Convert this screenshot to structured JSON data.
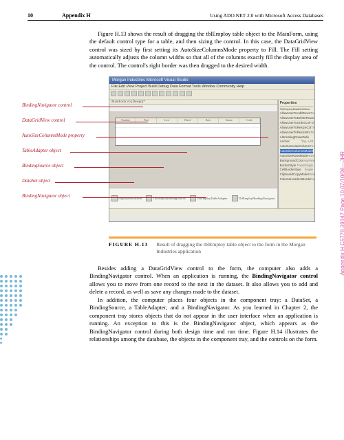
{
  "header": {
    "page_number": "10",
    "appendix": "Appendix H",
    "title": "Using ADO.NET 2.0 with Microsoft Access Databases"
  },
  "paragraphs": {
    "p1": "Figure H.13 shows the result of dragging the tblEmploy table object to the MainForm, using the default control type for a table, and then sizing the control. In this case, the DataGridView control was sized by first setting its AutoSizeColumnsMode property to Fill. The Fill setting automatically adjusts the column widths so that all of the columns exactly fill the display area of the control. The control's right border was then dragged to the desired width.",
    "p2a": "Besides adding a DataGridView control to the form, the computer also adds a BindingNavigator control. When an application is running, the ",
    "p2b": "BindingNavigator control",
    "p2c": " allows you to move from one record to the next in the dataset. It also allows you to add and delete a record, as well as save any changes made to the dataset.",
    "p3": "In addition, the computer places four objects in the component tray: a DataSet, a BindingSource, a TableAdapter, and a BindingNavigator. As you learned in Chapter 2, the component tray stores objects that do not appear in the user interface when an application is running. An exception to this is the BindingNavigator object, which appears as the BindingNavigator control during both design time and run time. Figure H.14 illustrates the relationships among the database, the objects in the component tray, and the controls on the form."
  },
  "annotations": {
    "a1": "BindingNavigator control",
    "a2": "DataGridView control",
    "a3": "AutoSizeColumnsMode property",
    "a4": "TableAdapter object",
    "a5": "BindingSource object",
    "a6": "DataSet object",
    "a7": "BindingNavigator object"
  },
  "screenshot": {
    "title": "Morgan Industries Microsoft Visual Studio",
    "menu": "File  Edit  View  Project  Build  Debug  Data  Format  Tools  Window  Community  Help",
    "tab": "MainForm.vb [Design]*",
    "nav_text": "0  of {0}",
    "grid_headers": [
      "Number",
      "First",
      "Last",
      "Hired",
      "Rate",
      "Status",
      "Code"
    ],
    "tray": [
      "EmployeesDataSet",
      "TblEmployBindingSource",
      "TblEmployTableAdapter",
      "TblEmployBindingNavigator"
    ],
    "props_title": "Properties",
    "props_sub": "TblEmployDataGridView",
    "props": [
      {
        "k": "AllowUserToAddRows",
        "v": "True"
      },
      {
        "k": "AllowUserToDeleteRows",
        "v": "True"
      },
      {
        "k": "AllowUserToOrderCol",
        "v": "False"
      },
      {
        "k": "AllowUserToResizeCol",
        "v": "True"
      },
      {
        "k": "AllowUserToResizeRo",
        "v": "True"
      },
      {
        "k": "AlternatingRowsDefa",
        "v": ""
      },
      {
        "k": "Anchor",
        "v": "Top, Left"
      },
      {
        "k": "AutoGenerateColumn",
        "v": "True"
      },
      {
        "k": "AutoSizeColumnsMode",
        "v": "Fill",
        "hl": true
      },
      {
        "k": "AutoSizeRowsMode",
        "v": "None"
      },
      {
        "k": "BackgroundColor",
        "v": "AppWork"
      },
      {
        "k": "BorderStyle",
        "v": "FixedSingle"
      },
      {
        "k": "CellBorderStyle",
        "v": "Single"
      },
      {
        "k": "ClipboardCopyMode",
        "v": "EnableWi"
      },
      {
        "k": "ColumnHeadersBorde",
        "v": "Raised"
      }
    ]
  },
  "caption": {
    "num": "FIGURE H.13",
    "text": "Result of dragging the tblEmploy table object to the form in the Morgan Industries application"
  },
  "side": {
    "pink": "Appendix H  C5779  39147  Page 10  07/10/06—JHR",
    "green": ""
  }
}
